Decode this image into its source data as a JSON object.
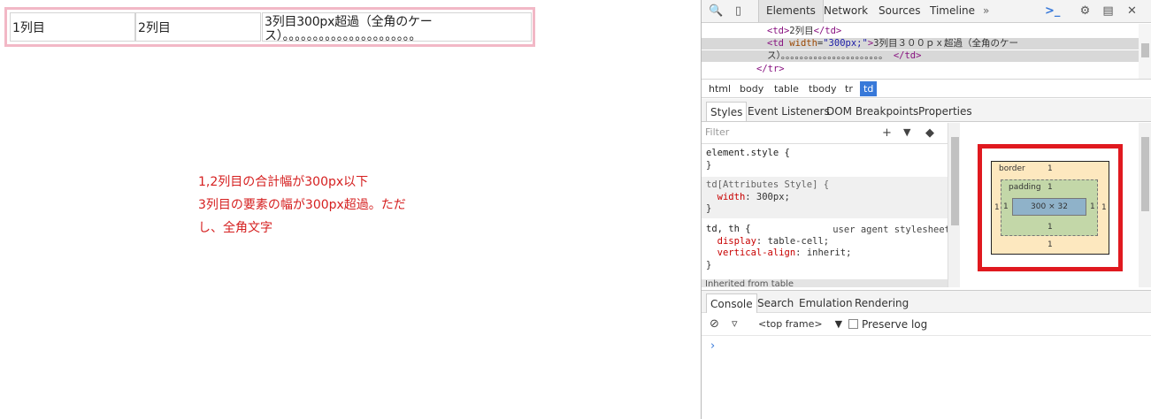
{
  "page": {
    "table": {
      "cells": [
        "1列目",
        "2列目",
        "3列目300px超過（全角のケース）。。。。。。。。。。。。。。。。。。。。。。"
      ]
    },
    "note": {
      "lines": [
        "1,2列目の合計幅が300px以下",
        "3列目の要素の幅が300px超過。ただ",
        "し、全角文字"
      ]
    }
  },
  "devtools": {
    "toolbar": {
      "tabs": [
        "Elements",
        "Network",
        "Sources",
        "Timeline"
      ],
      "more": "»",
      "search_icon": "magnifier-icon",
      "device_icon": "mobile-device-icon",
      "console_drawer": "terminal-icon",
      "settings_icon": "gear-icon",
      "dock_icon": "dock-icon",
      "close_icon": "close-icon"
    },
    "source": {
      "line1_tag_open": "<td>",
      "line1_text": "2列目",
      "line1_tag_close": "</td>",
      "line2_tag": "<td ",
      "line2_attr": "width",
      "line2_eq": "=",
      "line2_val": "\"300px;\"",
      "line2_tag_end": ">",
      "line2_text": "3列目３００ｐｘ超過（全角のケー",
      "line3_text": "ス）。。。。。。。。。。。。。。。。。。。。。。 ",
      "line3_tag": "</td>",
      "line4_tag": "</tr>"
    },
    "breadcrumbs": [
      "html",
      "body",
      "table",
      "tbody",
      "tr",
      "td"
    ],
    "subtabs": [
      "Styles",
      "Event Listeners",
      "DOM Breakpoints",
      "Properties"
    ],
    "styles": {
      "filter_placeholder": "Filter",
      "add_rule": "+",
      "pin": "📌",
      "toggle": "◆",
      "rule1_selector": "element.style {",
      "rule1_close": "}",
      "rule2_selector": "td[Attributes Style] {",
      "rule2_prop": "width",
      "rule2_val": ": 300px;",
      "rule2_close": "}",
      "rule3_selector": "td, th {",
      "rule3_source": "user agent stylesheet",
      "rule3_prop1": "display",
      "rule3_val1": ": table-cell;",
      "rule3_prop2": "vertical-align",
      "rule3_val2": ": inherit;",
      "rule3_close": "}",
      "inherited": "Inherited from table"
    },
    "metrics": {
      "border_label": "border",
      "border_top": "1",
      "border_bottom": "1",
      "border_left": "1",
      "border_right": "1",
      "padding_label": "padding",
      "padding_top": "1",
      "padding_bottom": "1",
      "padding_left": "1",
      "padding_right": "1",
      "content": "300 × 32"
    },
    "console": {
      "tabs": [
        "Console",
        "Search",
        "Emulation",
        "Rendering"
      ],
      "clear_icon": "no-entry-icon",
      "filter_icon": "funnel-icon",
      "frame": "<top frame>",
      "frame_arrow": "▼",
      "preserve_log": "Preserve log",
      "prompt": "›"
    },
    "colors": {
      "accent": "#3879d9",
      "highlight": "#e0191f"
    }
  }
}
